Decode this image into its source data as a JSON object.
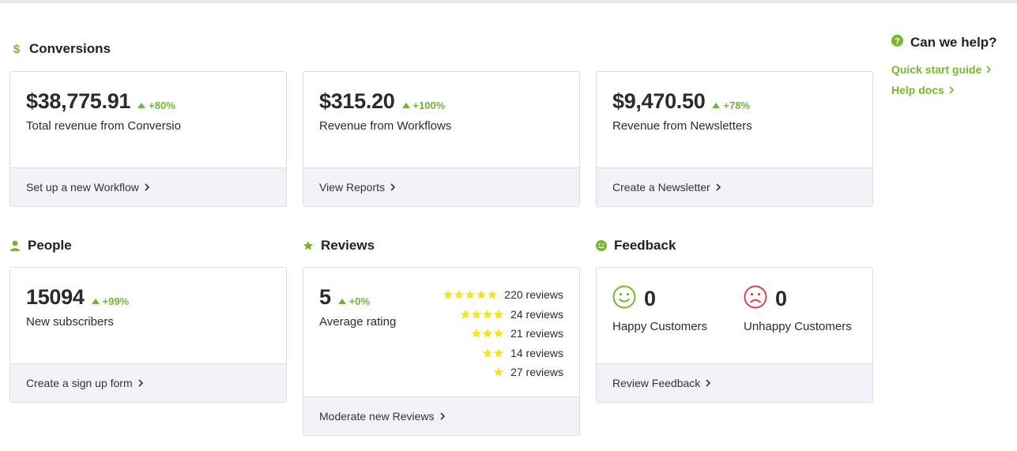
{
  "conversions": {
    "title": "Conversions",
    "cards": [
      {
        "value": "$38,775.91",
        "delta": "+80%",
        "label": "Total revenue from Conversio",
        "action": "Set up a new Workflow"
      },
      {
        "value": "$315.20",
        "delta": "+100%",
        "label": "Revenue from Workflows",
        "action": "View Reports"
      },
      {
        "value": "$9,470.50",
        "delta": "+78%",
        "label": "Revenue from Newsletters",
        "action": "Create a Newsletter"
      }
    ]
  },
  "people": {
    "title": "People",
    "value": "15094",
    "delta": "+99%",
    "label": "New subscribers",
    "action": "Create a sign up form"
  },
  "reviews": {
    "title": "Reviews",
    "value": "5",
    "delta": "+0%",
    "label": "Average rating",
    "action": "Moderate new Reviews",
    "breakdown": [
      {
        "stars": 5,
        "text": "220 reviews"
      },
      {
        "stars": 4,
        "text": "24 reviews"
      },
      {
        "stars": 3,
        "text": "21 reviews"
      },
      {
        "stars": 2,
        "text": "14 reviews"
      },
      {
        "stars": 1,
        "text": "27 reviews"
      }
    ]
  },
  "feedback": {
    "title": "Feedback",
    "happy_count": "0",
    "happy_label": "Happy Customers",
    "unhappy_count": "0",
    "unhappy_label": "Unhappy Customers",
    "action": "Review Feedback"
  },
  "help": {
    "title": "Can we help?",
    "links": [
      "Quick start guide",
      "Help docs"
    ]
  },
  "colors": {
    "accent": "#7ab52f",
    "delta": "#6fb637",
    "star": "#f5e32a",
    "sad": "#d9444b",
    "footer_bg": "#f2f3f9"
  },
  "icons": {
    "conversions": "dollar-icon",
    "people": "person-icon",
    "reviews": "star-icon",
    "feedback": "smiley-icon",
    "help": "question-circle-icon"
  }
}
